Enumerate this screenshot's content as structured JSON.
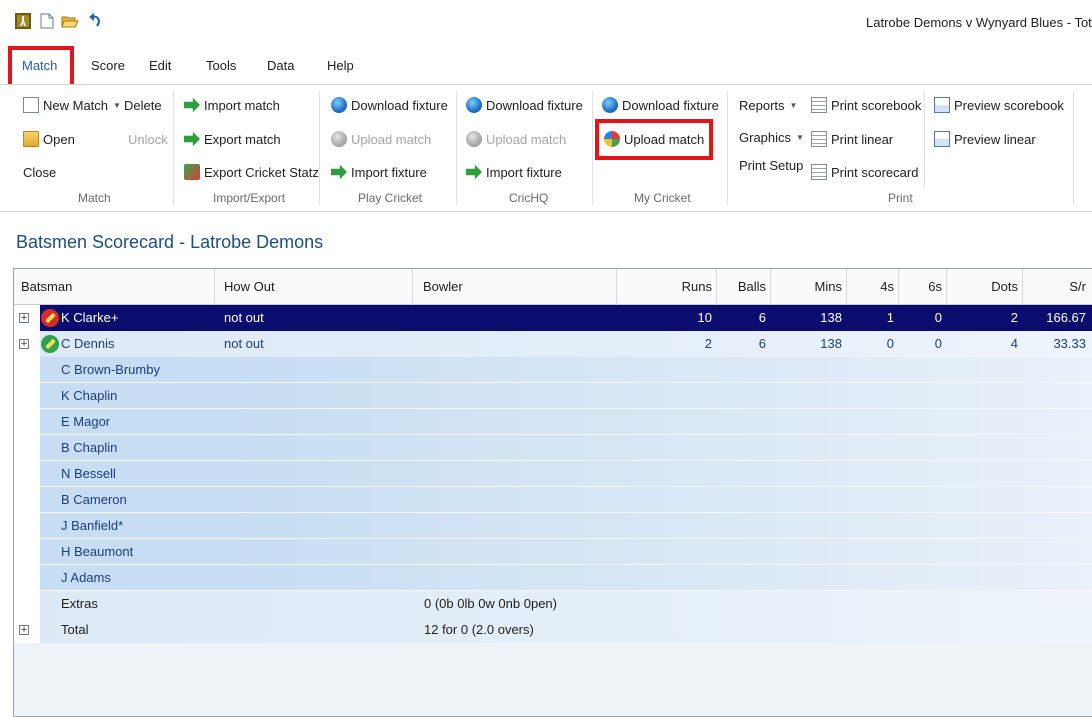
{
  "window": {
    "title": "Latrobe Demons v Wynyard Blues - Tota"
  },
  "menu_tabs": [
    "Match",
    "Score",
    "Edit",
    "Tools",
    "Data",
    "Help"
  ],
  "ribbon": {
    "groups": {
      "match": "Match",
      "import_export": "Import/Export",
      "play_cricket": "Play Cricket",
      "crichq": "CricHQ",
      "my_cricket": "My Cricket",
      "print": "Print"
    },
    "match": {
      "new_match": "New Match",
      "delete": "Delete",
      "open": "Open",
      "unlock": "Unlock",
      "close": "Close"
    },
    "import_export": {
      "import_match": "Import match",
      "export_match": "Export match",
      "export_statz": "Export Cricket Statz"
    },
    "play_cricket": {
      "download": "Download fixture",
      "upload": "Upload match",
      "import": "Import fixture"
    },
    "crichq": {
      "download": "Download fixture",
      "upload": "Upload match",
      "import": "Import fixture"
    },
    "my_cricket": {
      "download": "Download fixture",
      "upload": "Upload match"
    },
    "print": {
      "reports": "Reports",
      "graphics": "Graphics",
      "print_setup": "Print Setup",
      "print_scorebook": "Print scorebook",
      "print_linear": "Print linear",
      "print_scorecard": "Print scorecard",
      "preview_scorebook": "Preview scorebook",
      "preview_linear": "Preview linear"
    }
  },
  "scorecard": {
    "title": "Batsmen Scorecard - Latrobe Demons",
    "columns": {
      "batsman": "Batsman",
      "how_out": "How Out",
      "bowler": "Bowler",
      "runs": "Runs",
      "balls": "Balls",
      "mins": "Mins",
      "fours": "4s",
      "sixes": "6s",
      "dots": "Dots",
      "strike_rate": "S/r"
    },
    "batting": [
      {
        "name": "K Clarke+",
        "how_out": "not out",
        "runs": "10",
        "balls": "6",
        "mins": "138",
        "fours": "1",
        "sixes": "0",
        "dots": "2",
        "sr": "166.67"
      },
      {
        "name": "C Dennis",
        "how_out": "not out",
        "runs": "2",
        "balls": "6",
        "mins": "138",
        "fours": "0",
        "sixes": "0",
        "dots": "4",
        "sr": "33.33"
      }
    ],
    "yet_to_bat": [
      "C Brown-Brumby",
      "K Chaplin",
      "E Magor",
      "B Chaplin",
      "N Bessell",
      "B Cameron",
      "J Banfield*",
      "H Beaumont",
      "J Adams"
    ],
    "extras": {
      "label": "Extras",
      "value": "0 (0b 0lb 0w 0nb 0pen)"
    },
    "total": {
      "label": "Total",
      "value": "12 for 0  (2.0 overs)"
    }
  }
}
